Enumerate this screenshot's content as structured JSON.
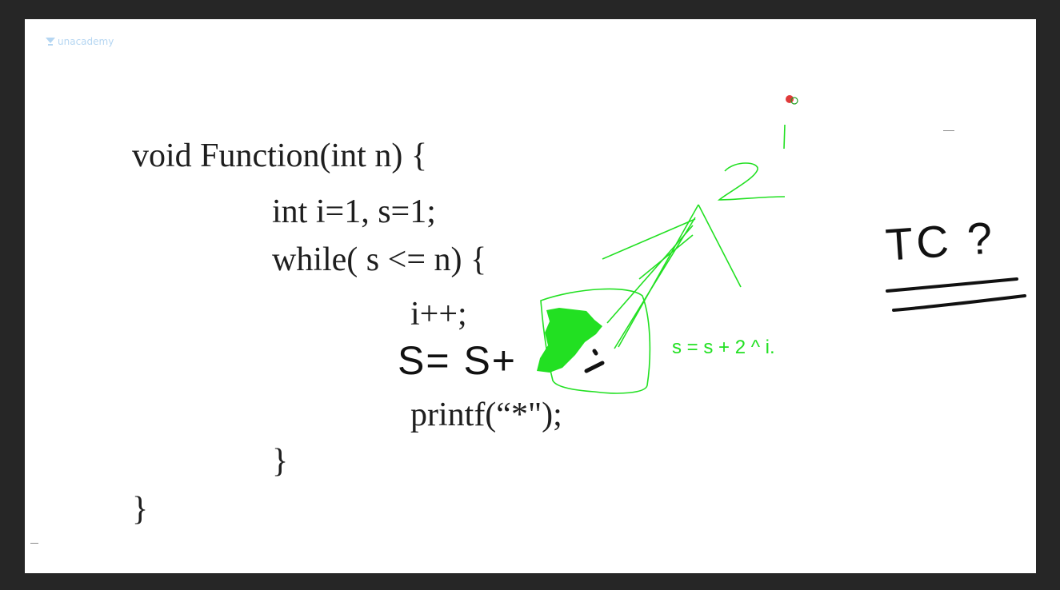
{
  "logo": {
    "text": "unacademy",
    "icon": "unacademy-logo-icon"
  },
  "code": {
    "line1": "void Function(int n) {",
    "line2": "int i=1, s=1;",
    "line3": "while( s <= n) {",
    "line4": "i++;",
    "line6": "printf(“*\");",
    "line7": "}",
    "line8": "}"
  },
  "annotations": {
    "handwritten_s_line": "S= S+",
    "handwritten_semicolon": ";",
    "green_note": "s = s + 2 ^ i.",
    "superscript_i": "i",
    "exponent_two": "2",
    "tc_label": "TC ?"
  },
  "colors": {
    "background": "#262626",
    "slide": "#ffffff",
    "code_text": "#1e1e1e",
    "green_pen": "#22e022",
    "black_pen": "#111111",
    "logo": "#b5d6f2",
    "laser_pointer": "#e03a3a"
  }
}
